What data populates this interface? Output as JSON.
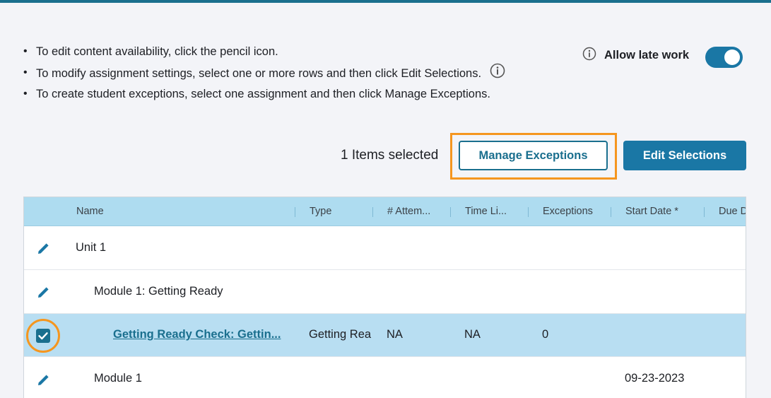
{
  "instructions": [
    "To edit content availability, click the pencil icon.",
    "To modify assignment settings, select one or more rows and then click Edit Selections.",
    "To create student exceptions, select one assignment and then click Manage Exceptions."
  ],
  "late_work": {
    "label": "Allow late work",
    "enabled": true
  },
  "selection": {
    "count_text": "1 Items selected",
    "manage_label": "Manage Exceptions",
    "edit_label": "Edit Selections"
  },
  "table": {
    "columns": [
      "Name",
      "Type",
      "# Attem...",
      "Time Li...",
      "Exceptions",
      "Start Date *",
      "Due D"
    ],
    "rows": [
      {
        "name": "Unit 1",
        "type": "",
        "attempts": "",
        "time_limit": "",
        "exceptions": "",
        "start_date": ""
      },
      {
        "name": "Module 1: Getting Ready",
        "type": "",
        "attempts": "",
        "time_limit": "",
        "exceptions": "",
        "start_date": ""
      },
      {
        "name": "Getting Ready Check: Gettin...",
        "type": "Getting Rea",
        "attempts": "NA",
        "time_limit": "NA",
        "exceptions": "0",
        "start_date": "",
        "selected": true
      },
      {
        "name": "Module 1",
        "type": "",
        "attempts": "",
        "time_limit": "",
        "exceptions": "",
        "start_date": "09-23-2023"
      }
    ]
  },
  "colors": {
    "accent": "#1a6f8e",
    "highlight": "#f5961f",
    "header_bg": "#aedcf0",
    "selected_row": "#b8def2"
  }
}
